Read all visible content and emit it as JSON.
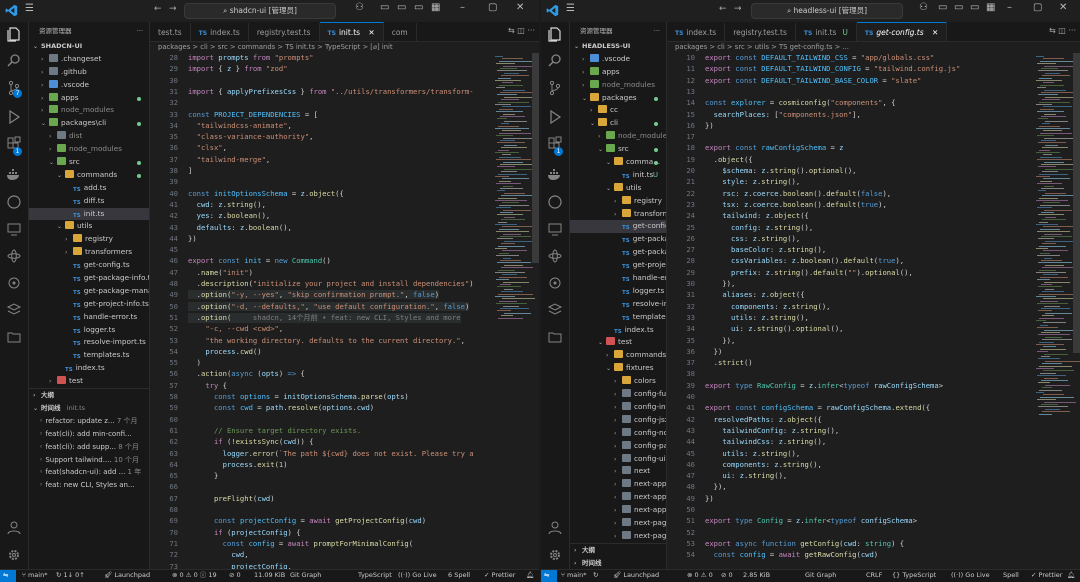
{
  "left": {
    "title": "shadcn-ui [管理员]",
    "explorer_title": "资源管理器",
    "project": "SHADCN-UI",
    "tree": [
      {
        "label": ".changeset",
        "depth": 1,
        "type": "folder",
        "color": "grey",
        "chev": "›"
      },
      {
        "label": ".github",
        "depth": 1,
        "type": "folder",
        "color": "grey",
        "chev": "›"
      },
      {
        "label": ".vscode",
        "depth": 1,
        "type": "folder",
        "color": "blue",
        "chev": "›"
      },
      {
        "label": "apps",
        "depth": 1,
        "type": "folder",
        "color": "green",
        "chev": "›",
        "dot": true
      },
      {
        "label": "node_modules",
        "depth": 1,
        "type": "folder",
        "color": "green",
        "chev": "›",
        "muted": true
      },
      {
        "label": "packages\\cli",
        "depth": 1,
        "type": "folder",
        "color": "green",
        "chev": "⌄",
        "dot": true
      },
      {
        "label": "dist",
        "depth": 2,
        "type": "folder",
        "color": "grey",
        "chev": "›",
        "muted": true
      },
      {
        "label": "node_modules",
        "depth": 2,
        "type": "folder",
        "color": "green",
        "chev": "›",
        "muted": true
      },
      {
        "label": "src",
        "depth": 2,
        "type": "folder",
        "color": "green",
        "chev": "⌄",
        "dot": true
      },
      {
        "label": "commands",
        "depth": 3,
        "type": "folder",
        "color": "yellow",
        "chev": "⌄",
        "dot": true
      },
      {
        "label": "add.ts",
        "depth": 4,
        "type": "ts"
      },
      {
        "label": "diff.ts",
        "depth": 4,
        "type": "ts"
      },
      {
        "label": "init.ts",
        "depth": 4,
        "type": "ts",
        "selected": true
      },
      {
        "label": "utils",
        "depth": 3,
        "type": "folder",
        "color": "yellow",
        "chev": "⌄"
      },
      {
        "label": "registry",
        "depth": 4,
        "type": "folder",
        "color": "yellow",
        "chev": "›"
      },
      {
        "label": "transformers",
        "depth": 4,
        "type": "folder",
        "color": "yellow",
        "chev": "›"
      },
      {
        "label": "get-config.ts",
        "depth": 4,
        "type": "ts"
      },
      {
        "label": "get-package-info.ts",
        "depth": 4,
        "type": "ts"
      },
      {
        "label": "get-package-mana...",
        "depth": 4,
        "type": "ts"
      },
      {
        "label": "get-project-info.ts",
        "depth": 4,
        "type": "ts"
      },
      {
        "label": "handle-error.ts",
        "depth": 4,
        "type": "ts"
      },
      {
        "label": "logger.ts",
        "depth": 4,
        "type": "ts"
      },
      {
        "label": "resolve-import.ts",
        "depth": 4,
        "type": "ts"
      },
      {
        "label": "templates.ts",
        "depth": 4,
        "type": "ts"
      },
      {
        "label": "index.ts",
        "depth": 3,
        "type": "ts"
      },
      {
        "label": "test",
        "depth": 2,
        "type": "folder",
        "color": "red",
        "chev": "›"
      }
    ],
    "outline_label": "大纲",
    "timeline_label": "时间线",
    "timeline_file": "init.ts",
    "timeline": [
      {
        "text": "refactor: update z...",
        "time": "7 个月"
      },
      {
        "text": "feat(cli): add min-confi...",
        "time": ""
      },
      {
        "text": "feat(cli): add supp...",
        "time": "8 个月"
      },
      {
        "text": "Support tailwind....",
        "time": "10 个月"
      },
      {
        "text": "feat(shadcn-ui): add ...",
        "time": "1 年"
      },
      {
        "text": "feat: new CLI, Styles an...",
        "time": ""
      }
    ],
    "tabs": [
      {
        "label": "test.ts",
        "ts": false
      },
      {
        "label": "index.ts",
        "ts": true
      },
      {
        "label": "registry.test.ts",
        "ts": false
      },
      {
        "label": "init.ts",
        "ts": true,
        "active": true
      },
      {
        "label": "com",
        "ts": false
      }
    ],
    "breadcrumb": "packages > cli > src > commands > TS init.ts > TypeScript > [⌀] init",
    "first_line": 28,
    "status": {
      "branch": "main*",
      "sync": "↻ 1↓ 0↑",
      "launch": "Launchpad",
      "problems": "⊗ 0 ⚠ 0 ⓘ 19",
      "info": "⊘ 0",
      "size": "11.09 KiB",
      "graph": "Git Graph",
      "lang": "TypeScript",
      "live": "Go Live",
      "spell": "6 Spell",
      "prettier": "Prettier"
    },
    "ghost": "shadcn, 14个月前 • feat: new CLI, Styles and more"
  },
  "right": {
    "title": "headless-ui [管理员]",
    "explorer_title": "资源管理器",
    "project": "HEADLESS-UI",
    "tree": [
      {
        "label": ".vscode",
        "depth": 1,
        "type": "folder",
        "color": "blue",
        "chev": "›"
      },
      {
        "label": "apps",
        "depth": 1,
        "type": "folder",
        "color": "green",
        "chev": "›"
      },
      {
        "label": "node_modules",
        "depth": 1,
        "type": "folder",
        "color": "green",
        "chev": "›",
        "muted": true
      },
      {
        "label": "packages",
        "depth": 1,
        "type": "folder",
        "color": "yellow",
        "chev": "⌄",
        "dot": true
      },
      {
        "label": "cc",
        "depth": 2,
        "type": "folder",
        "color": "yellow",
        "chev": "›"
      },
      {
        "label": "cli",
        "depth": 2,
        "type": "folder",
        "color": "yellow",
        "chev": "⌄",
        "dot": true
      },
      {
        "label": "node_modules",
        "depth": 3,
        "type": "folder",
        "color": "green",
        "chev": "›",
        "muted": true
      },
      {
        "label": "src",
        "depth": 3,
        "type": "folder",
        "color": "green",
        "chev": "⌄",
        "dot": true
      },
      {
        "label": "comma...",
        "depth": 4,
        "type": "folder",
        "color": "yellow",
        "chev": "⌄",
        "dot": true
      },
      {
        "label": "init.ts",
        "depth": 5,
        "type": "ts",
        "u": "U"
      },
      {
        "label": "utils",
        "depth": 4,
        "type": "folder",
        "color": "yellow",
        "chev": "⌄"
      },
      {
        "label": "registry",
        "depth": 5,
        "type": "folder",
        "color": "yellow",
        "chev": "›"
      },
      {
        "label": "transformers",
        "depth": 5,
        "type": "folder",
        "color": "yellow",
        "chev": "›"
      },
      {
        "label": "get-config.ts",
        "depth": 5,
        "type": "ts",
        "selected": true
      },
      {
        "label": "get-packag...",
        "depth": 5,
        "type": "ts"
      },
      {
        "label": "get-packag...",
        "depth": 5,
        "type": "ts"
      },
      {
        "label": "get-project-...",
        "depth": 5,
        "type": "ts"
      },
      {
        "label": "handle-erro...",
        "depth": 5,
        "type": "ts"
      },
      {
        "label": "logger.ts",
        "depth": 5,
        "type": "ts"
      },
      {
        "label": "resolve-imp...",
        "depth": 5,
        "type": "ts"
      },
      {
        "label": "templates.ts",
        "depth": 5,
        "type": "ts"
      },
      {
        "label": "index.ts",
        "depth": 4,
        "type": "ts"
      },
      {
        "label": "test",
        "depth": 3,
        "type": "folder",
        "color": "red",
        "chev": "⌄"
      },
      {
        "label": "commands",
        "depth": 4,
        "type": "folder",
        "color": "yellow",
        "chev": "›"
      },
      {
        "label": "fixtures",
        "depth": 4,
        "type": "folder",
        "color": "yellow",
        "chev": "⌄"
      },
      {
        "label": "colors",
        "depth": 5,
        "type": "folder",
        "color": "yellow",
        "chev": "›"
      },
      {
        "label": "config-full",
        "depth": 5,
        "type": "folder",
        "color": "grey",
        "chev": "›"
      },
      {
        "label": "config-invalid",
        "depth": 5,
        "type": "folder",
        "color": "grey",
        "chev": "›"
      },
      {
        "label": "config-jsx",
        "depth": 5,
        "type": "folder",
        "color": "grey",
        "chev": "›"
      },
      {
        "label": "config-none",
        "depth": 5,
        "type": "folder",
        "color": "grey",
        "chev": "›"
      },
      {
        "label": "config-partial",
        "depth": 5,
        "type": "folder",
        "color": "grey",
        "chev": "›"
      },
      {
        "label": "config-ui",
        "depth": 5,
        "type": "folder",
        "color": "grey",
        "chev": "›"
      },
      {
        "label": "next",
        "depth": 5,
        "type": "folder",
        "color": "grey",
        "chev": "›"
      },
      {
        "label": "next-app",
        "depth": 5,
        "type": "folder",
        "color": "grey",
        "chev": "›"
      },
      {
        "label": "next-app-js",
        "depth": 5,
        "type": "folder",
        "color": "grey",
        "chev": "›"
      },
      {
        "label": "next-app-src",
        "depth": 5,
        "type": "folder",
        "color": "grey",
        "chev": "›"
      },
      {
        "label": "next-pages",
        "depth": 5,
        "type": "folder",
        "color": "grey",
        "chev": "›"
      },
      {
        "label": "next-pages-...",
        "depth": 5,
        "type": "folder",
        "color": "grey",
        "chev": "›"
      }
    ],
    "outline_label": "大纲",
    "timeline_label": "时间线",
    "tabs": [
      {
        "label": "index.ts",
        "ts": true
      },
      {
        "label": "registry.test.ts",
        "ts": false
      },
      {
        "label": "init.ts",
        "ts": true,
        "u": "U"
      },
      {
        "label": "get-config.ts",
        "ts": true,
        "active": true,
        "italic": true
      }
    ],
    "breadcrumb": "packages > cli > src > utils > TS get-config.ts > ...",
    "first_line": 10,
    "status": {
      "branch": "main*",
      "sync": "↻",
      "launch": "Launchpad",
      "problems": "⊗ 0 ⚠ 0",
      "info": "⊘ 0",
      "size": "2.85 KiB",
      "graph": "Git Graph",
      "crlf": "CRLF",
      "lang": "{} TypeScript",
      "live": "Go Live",
      "spell": "Spell",
      "prettier": "Prettier"
    }
  }
}
